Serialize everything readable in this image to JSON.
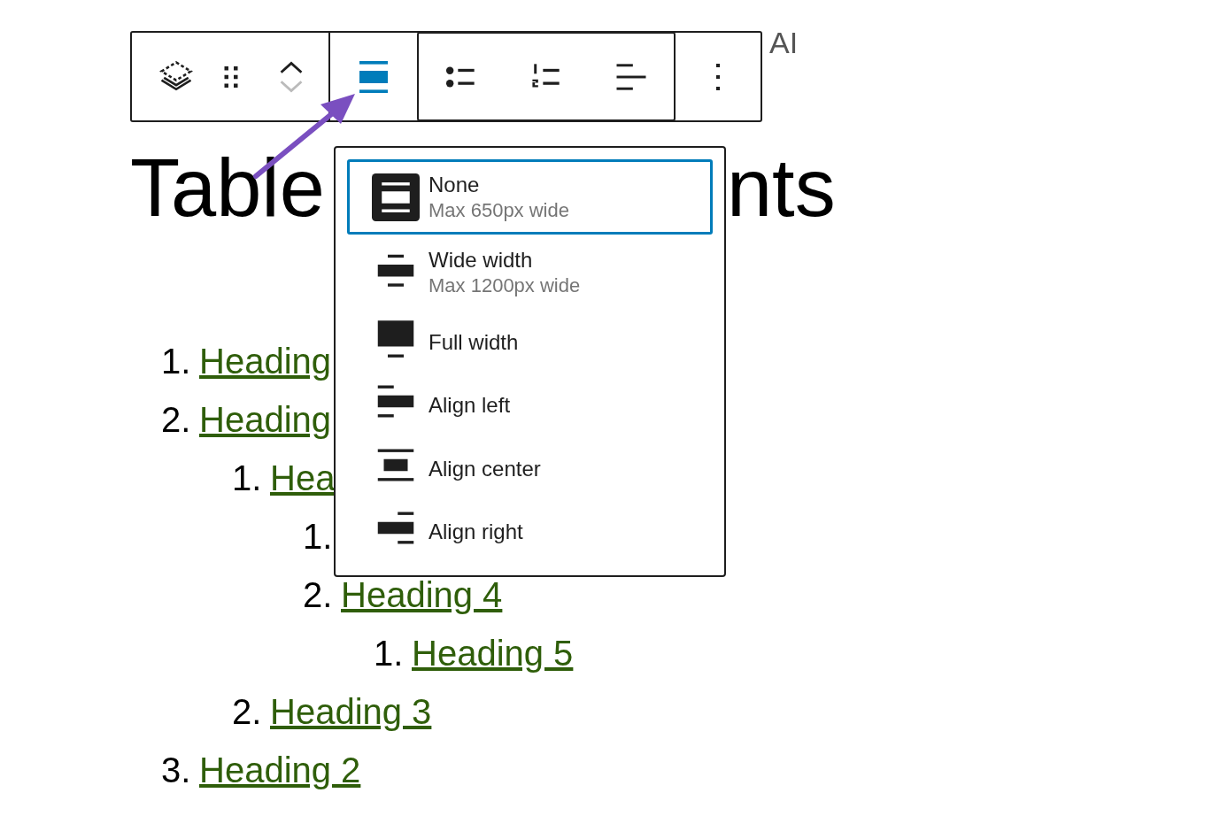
{
  "toolbar": {
    "align_button": {
      "selected": true
    },
    "ai_label": "AI"
  },
  "heading": {
    "visible_parts": [
      "Table",
      "nts"
    ]
  },
  "list": [
    {
      "number": "1.",
      "text": "Heading"
    },
    {
      "number": "2.",
      "text": "Heading",
      "children": [
        {
          "number": "1.",
          "text": "Hea",
          "children": [
            {
              "number": "1."
            },
            {
              "number": "2.",
              "text": "Heading 4",
              "children": [
                {
                  "number": "1.",
                  "text": "Heading 5"
                }
              ]
            }
          ]
        },
        {
          "number": "2.",
          "text": "Heading 3"
        }
      ]
    },
    {
      "number": "3.",
      "text": "Heading 2"
    }
  ],
  "menu": {
    "items": [
      {
        "kind": "none",
        "label": "None",
        "description": "Max 650px wide",
        "selected": true
      },
      {
        "kind": "wide",
        "label": "Wide width",
        "description": "Max 1200px wide",
        "selected": false
      },
      {
        "kind": "full",
        "label": "Full width",
        "selected": false
      },
      {
        "kind": "left",
        "label": "Align left",
        "selected": false
      },
      {
        "kind": "center",
        "label": "Align center",
        "selected": false
      },
      {
        "kind": "right",
        "label": "Align right",
        "selected": false
      }
    ]
  }
}
